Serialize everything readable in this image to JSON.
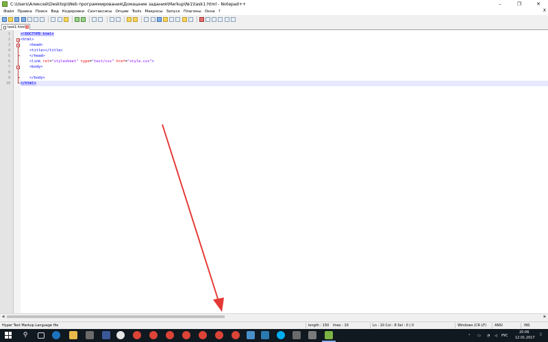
{
  "window": {
    "title": "C:\\Users\\Алексей\\Desktop\\Web программирования\\Домашние задания\\Markup\\№1\\task1.html - Notepad++",
    "minimize": "–",
    "maximize": "❐",
    "close": "✕"
  },
  "menu": {
    "items": [
      "Файл",
      "Правка",
      "Поиск",
      "Вид",
      "Кодировки",
      "Синтаксисы",
      "Опции",
      "Tools",
      "Макросы",
      "Запуск",
      "Плагины",
      "Окна",
      "?"
    ],
    "close": "X"
  },
  "tab": {
    "label": "task1.html",
    "close": "x"
  },
  "editor": {
    "lines": [
      {
        "n": "1",
        "text": "<!DOCTYPE html>"
      },
      {
        "n": "2",
        "text": "<html>"
      },
      {
        "n": "3",
        "text": "    <head>"
      },
      {
        "n": "4",
        "text": "    <title></title>"
      },
      {
        "n": "5",
        "text": "    </head>"
      },
      {
        "n": "6",
        "text": "    <link rel=\"stylesheet\" type=\"text/css\" href=\"style.css\">"
      },
      {
        "n": "7",
        "text": "    <body>"
      },
      {
        "n": "8",
        "text": ""
      },
      {
        "n": "9",
        "text": "    </body>"
      },
      {
        "n": "10",
        "text": "</html>"
      }
    ]
  },
  "status": {
    "filetype": "Hyper Text Markup Language file",
    "length": "length : 150",
    "lines": "lines : 10",
    "position": "Ln : 10    Col : 8    Sel : 0 | 0",
    "eol": "Windows (CR LF)",
    "encoding": "ANSI",
    "mode": "INS"
  },
  "taskbar": {
    "lang": "РУС",
    "time": "20:06",
    "date": "12.01.2017"
  },
  "colors": {
    "tag": "#0000ff",
    "attr": "#ff0000",
    "value": "#8000ff",
    "arrow": "#e53935",
    "active_line": "#e8e8ff"
  }
}
